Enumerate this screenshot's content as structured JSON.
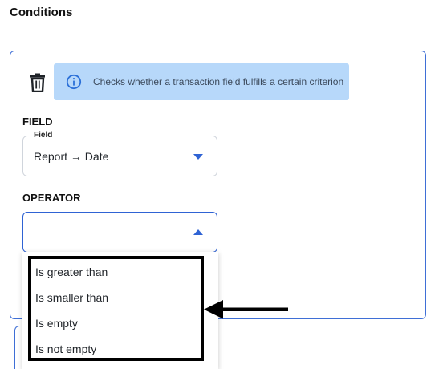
{
  "section": {
    "title": "Conditions"
  },
  "info_banner": {
    "text": "Checks whether a transaction field fulfills a certain criterion"
  },
  "field_group": {
    "heading": "FIELD",
    "select": {
      "floating_label": "Field",
      "value": "Report → Date"
    }
  },
  "operator_group": {
    "heading": "OPERATOR",
    "select": {
      "value": "",
      "state": "open"
    },
    "options": [
      "Is greater than",
      "Is smaller than",
      "Is empty",
      "Is not empty"
    ]
  },
  "icons": {
    "delete": "trash-icon",
    "info": "info-circle-icon",
    "field_caret": "chevron-down-icon",
    "operator_caret": "chevron-up-icon",
    "annotation": "arrow-left-icon"
  },
  "colors": {
    "accent": "#2f63d4",
    "card_border": "#3f6fd6",
    "info_background": "#b7d8fa",
    "annotation": "#000000"
  }
}
